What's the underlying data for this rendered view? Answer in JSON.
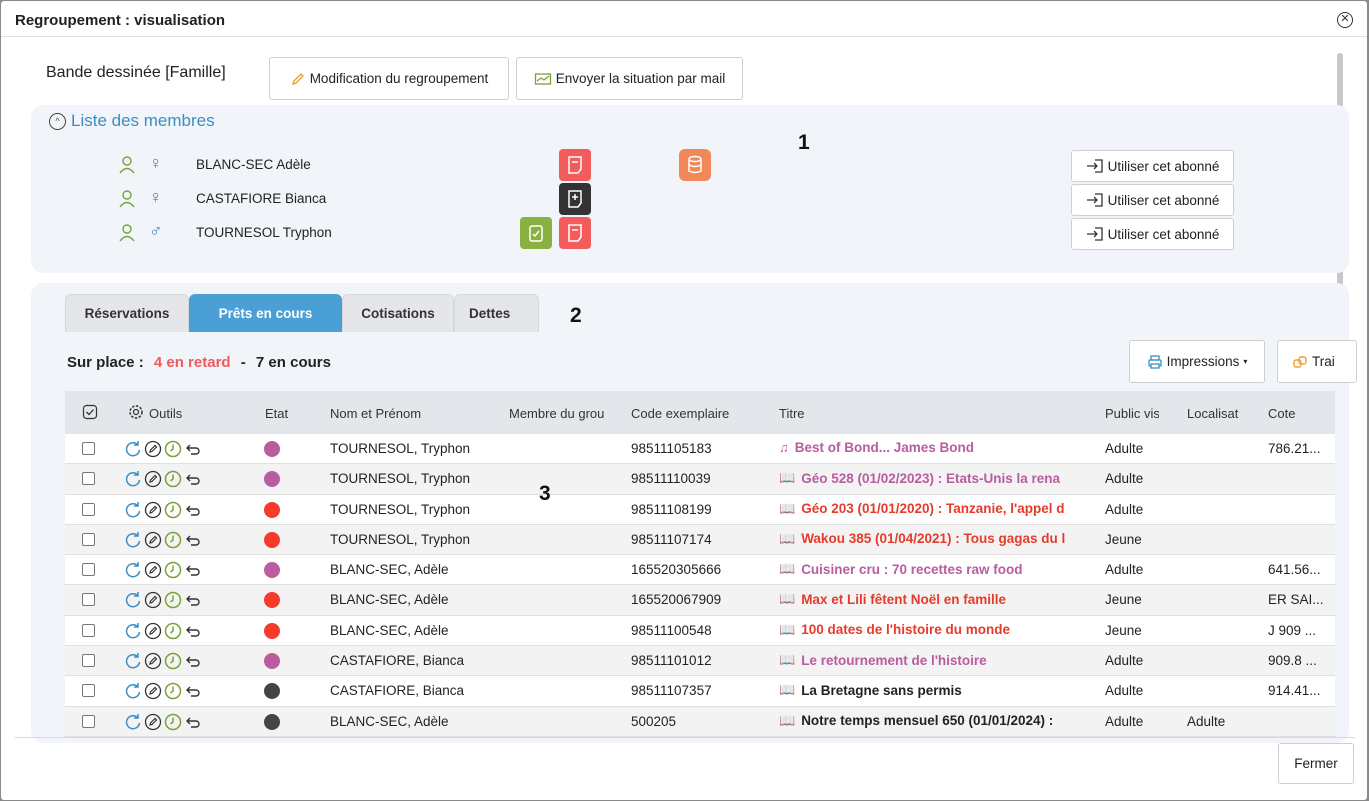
{
  "dialog": {
    "title": "Regroupement : visualisation",
    "close": "✕"
  },
  "group": {
    "name": "Bande dessinée [Famille]"
  },
  "actions": {
    "modify": "Modification du regroupement",
    "mail": "Envoyer la situation par mail"
  },
  "members_panel": {
    "title": "Liste des membres",
    "marker": "1",
    "use_label": "Utiliser cet abonné",
    "members": [
      {
        "name": "BLANC-SEC Adèle",
        "sex": "♀"
      },
      {
        "name": "CASTAFIORE Bianca",
        "sex": "♀"
      },
      {
        "name": "TOURNESOL Tryphon",
        "sex": "♂"
      }
    ]
  },
  "tabs_panel": {
    "marker": "2",
    "tabs": [
      "Réservations",
      "Prêts en cours",
      "Cotisations",
      "Dettes"
    ],
    "active_tab": "Prêts en cours",
    "summary": {
      "prefix": "Sur place :",
      "late": "4 en retard",
      "sep": "-",
      "current": "7 en cours"
    },
    "print_label": "Impressions",
    "trai_label": "Trai"
  },
  "table": {
    "marker": "3",
    "headers": [
      "Outils",
      "Etat",
      "Nom et Prénom",
      "Membre du grou",
      "Code exemplaire",
      "Titre",
      "Public vis",
      "Localisat",
      "Cote"
    ],
    "rows": [
      {
        "state": "#b95ca0",
        "name": "TOURNESOL, Tryphon",
        "member": "",
        "code": "98511105183",
        "icon": "♫",
        "title": "Best of Bond... James Bond",
        "tcolor": "#b95ca0",
        "public": "Adulte",
        "loc": "",
        "cote": "786.21..."
      },
      {
        "state": "#b95ca0",
        "name": "TOURNESOL, Tryphon",
        "member": "",
        "code": "98511110039",
        "icon": "📖",
        "title": "Géo 528 (01/02/2023) : Etats-Unis la rena",
        "tcolor": "#b95ca0",
        "public": "Adulte",
        "loc": "",
        "cote": ""
      },
      {
        "state": "#f53b2b",
        "name": "TOURNESOL, Tryphon",
        "member": "",
        "code": "98511108199",
        "icon": "📖",
        "title": "Géo 203 (01/01/2020) : Tanzanie, l'appel d",
        "tcolor": "#e53b2b",
        "public": "Adulte",
        "loc": "",
        "cote": ""
      },
      {
        "state": "#f53b2b",
        "name": "TOURNESOL, Tryphon",
        "member": "",
        "code": "98511107174",
        "icon": "📖",
        "title": "Wakou 385 (01/04/2021) : Tous gagas du l",
        "tcolor": "#e53b2b",
        "public": "Jeune",
        "loc": "",
        "cote": ""
      },
      {
        "state": "#b95ca0",
        "name": "BLANC-SEC, Adèle",
        "member": "",
        "code": "165520305666",
        "icon": "📖",
        "title": "Cuisiner cru : 70 recettes raw food",
        "tcolor": "#b95ca0",
        "public": "Adulte",
        "loc": "",
        "cote": "641.56..."
      },
      {
        "state": "#f53b2b",
        "name": "BLANC-SEC, Adèle",
        "member": "",
        "code": "165520067909",
        "icon": "📖",
        "title": "Max et Lili fêtent Noël en famille",
        "tcolor": "#e53b2b",
        "public": "Jeune",
        "loc": "",
        "cote": "ER SAI..."
      },
      {
        "state": "#f53b2b",
        "name": "BLANC-SEC, Adèle",
        "member": "",
        "code": "98511100548",
        "icon": "📖",
        "title": "100 dates de l'histoire du monde",
        "tcolor": "#e53b2b",
        "public": "Jeune",
        "loc": "",
        "cote": "J 909 ..."
      },
      {
        "state": "#b95ca0",
        "name": "CASTAFIORE, Bianca",
        "member": "",
        "code": "98511101012",
        "icon": "📖",
        "title": "Le retournement de l'histoire",
        "tcolor": "#b95ca0",
        "public": "Adulte",
        "loc": "",
        "cote": "909.8 ..."
      },
      {
        "state": "#444444",
        "name": "CASTAFIORE, Bianca",
        "member": "",
        "code": "98511107357",
        "icon": "📖",
        "title": "La Bretagne sans permis",
        "tcolor": "#222222",
        "public": "Adulte",
        "loc": "",
        "cote": "914.41..."
      },
      {
        "state": "#444444",
        "name": "BLANC-SEC, Adèle",
        "member": "",
        "code": "500205",
        "icon": "📖",
        "title": "Notre temps mensuel 650 (01/01/2024) :",
        "tcolor": "#222222",
        "public": "Adulte",
        "loc": "Adulte",
        "cote": ""
      }
    ]
  },
  "footer": {
    "close": "Fermer"
  },
  "colors": {
    "accent": "#4a9fd5",
    "late": "#f05a5a",
    "panel": "#f1f4f8"
  }
}
